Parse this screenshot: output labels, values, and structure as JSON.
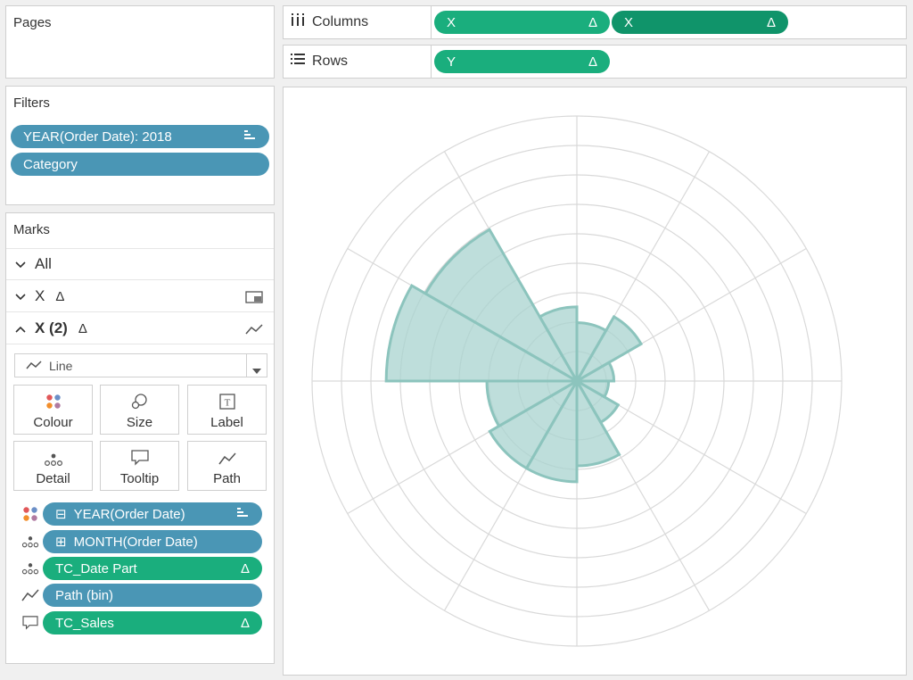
{
  "pages": {
    "title": "Pages"
  },
  "filters": {
    "title": "Filters",
    "items": [
      {
        "label": "YEAR(Order Date): 2018",
        "icon": "sort-icon"
      },
      {
        "label": "Category"
      }
    ]
  },
  "marks": {
    "title": "Marks",
    "rows": [
      {
        "label": "All",
        "icon": "chevron-down-icon"
      },
      {
        "label": "X",
        "delta": "Δ",
        "icon": "chevron-down-icon",
        "type_icon": "square-icon"
      },
      {
        "label": "X (2)",
        "delta": "Δ",
        "icon": "chevron-up-icon",
        "type_icon": "line-icon"
      }
    ],
    "mark_type": "Line",
    "buttons": [
      "Colour",
      "Size",
      "Label",
      "Detail",
      "Tooltip",
      "Path"
    ],
    "fields": [
      {
        "icon": "colour-icon",
        "label": "YEAR(Order Date)",
        "prefix": "⊟",
        "color": "blue",
        "suffix_icon": "sort-icon"
      },
      {
        "icon": "detail-icon",
        "label": "MONTH(Order Date)",
        "prefix": "⊞",
        "color": "blue"
      },
      {
        "icon": "detail-icon",
        "label": "TC_Date Part",
        "color": "green",
        "delta": "Δ"
      },
      {
        "icon": "path-icon",
        "label": "Path (bin)",
        "color": "blue"
      },
      {
        "icon": "tooltip-icon",
        "label": "TC_Sales",
        "color": "green",
        "delta": "Δ"
      }
    ]
  },
  "shelves": {
    "columns": {
      "label": "Columns",
      "pills": [
        {
          "label": "X",
          "delta": "Δ"
        },
        {
          "label": "X",
          "delta": "Δ"
        }
      ]
    },
    "rows": {
      "label": "Rows",
      "pills": [
        {
          "label": "Y",
          "delta": "Δ"
        }
      ]
    }
  },
  "colors": {
    "blue_pill": "#4a96b5",
    "green_pill": "#1aae7d",
    "green_pill_dark": "#10946a",
    "shape_fill": "#a8d3cf",
    "shape_stroke": "#8cc4bd",
    "grid": "#d9d9d9"
  },
  "chart": {
    "type": "radial",
    "rings": 9,
    "spokes": 12,
    "petals": [
      0.22,
      0.28,
      0.14,
      0.12,
      0.18,
      0.32,
      0.38,
      0.38,
      0.34,
      0.72,
      0.66,
      0.28
    ]
  }
}
